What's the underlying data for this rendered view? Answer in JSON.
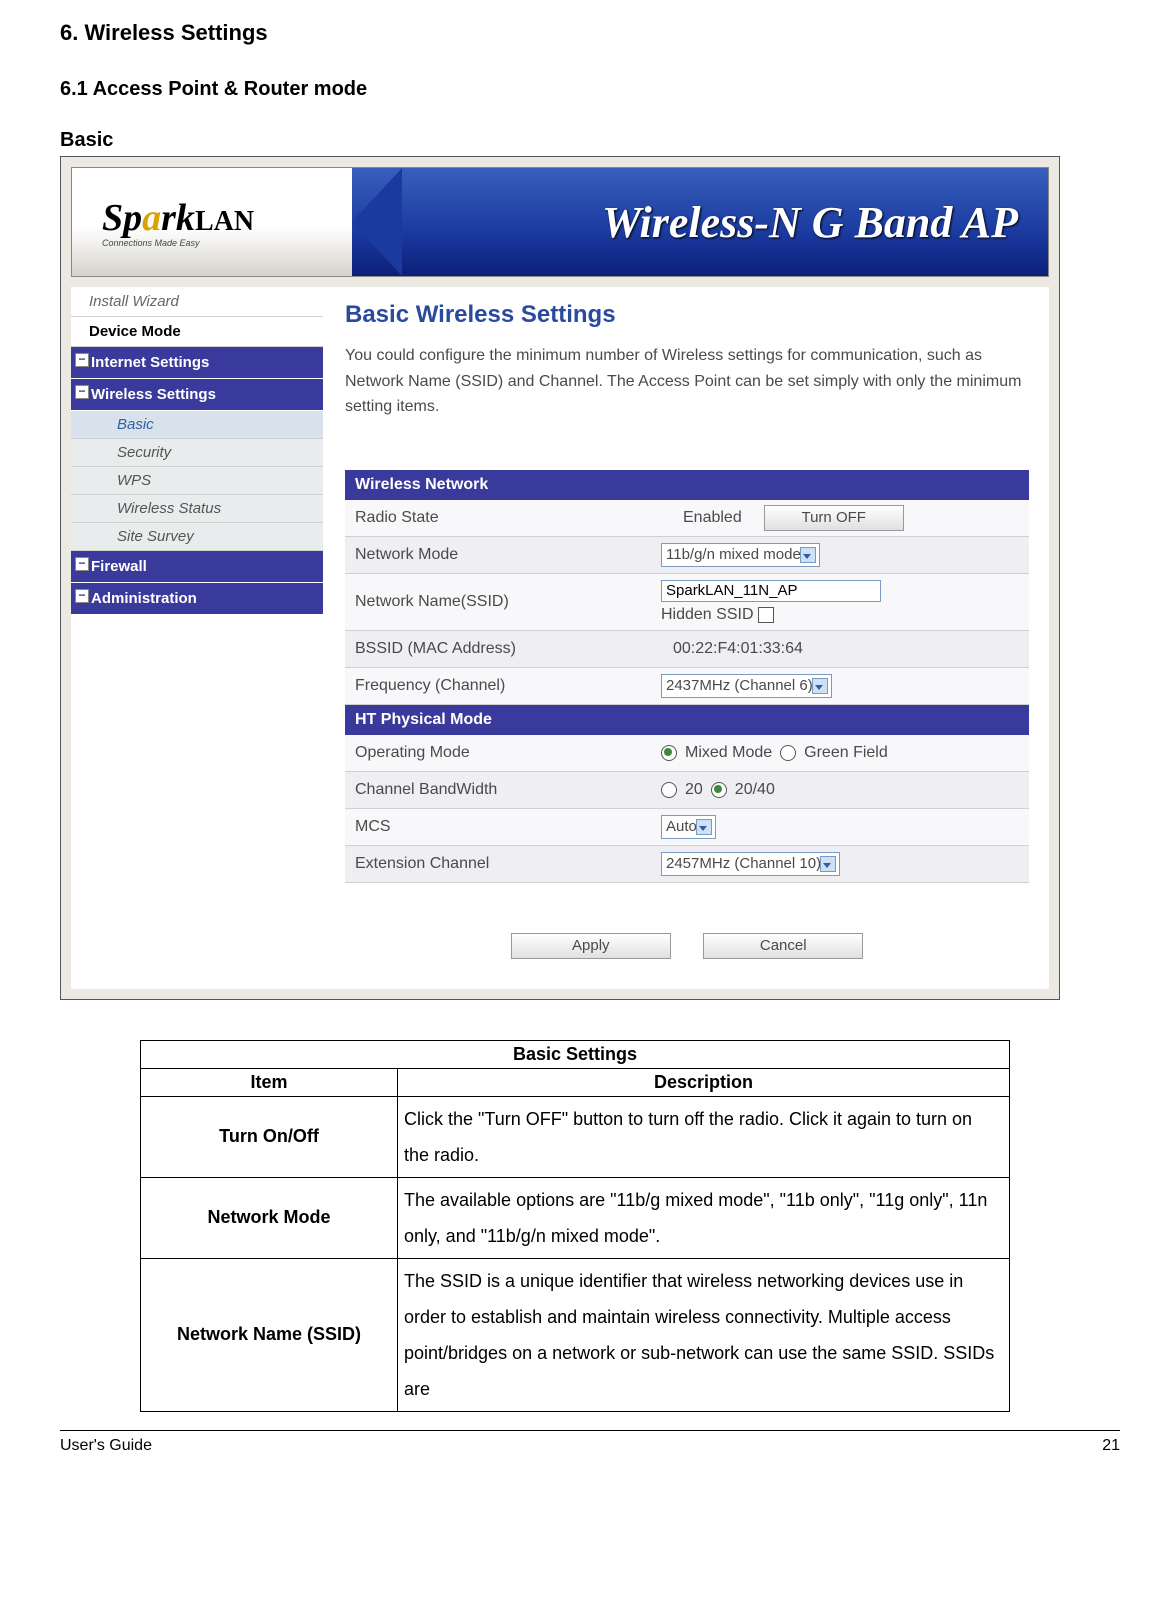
{
  "doc": {
    "h1": "6. Wireless Settings",
    "h2": "6.1 Access Point & Router mode",
    "h3": "Basic"
  },
  "banner": {
    "brand_prefix": "Sp",
    "brand_accent": "a",
    "brand_suffix": "rk",
    "brand_tail": "LAN",
    "brand_tagline": "Connections Made Easy",
    "slogan": "Wireless-N G Band AP"
  },
  "sidebar": {
    "install_wizard": "Install Wizard",
    "device_mode": "Device Mode",
    "internet_settings": "Internet Settings",
    "wireless_settings": "Wireless Settings",
    "sub": {
      "basic": "Basic",
      "security": "Security",
      "wps": "WPS",
      "wireless_status": "Wireless Status",
      "site_survey": "Site Survey"
    },
    "firewall": "Firewall",
    "administration": "Administration"
  },
  "content": {
    "title": "Basic Wireless Settings",
    "desc": "You could configure the minimum number of Wireless settings for communication, such as Network Name (SSID) and Channel. The Access Point can be set simply with only the minimum setting items.",
    "section1": "Wireless Network",
    "radio_state_label": "Radio State",
    "radio_state_value": "Enabled",
    "radio_button": "Turn OFF",
    "network_mode_label": "Network Mode",
    "network_mode_value": "11b/g/n mixed mode",
    "ssid_label": "Network Name(SSID)",
    "ssid_value": "SparkLAN_11N_AP",
    "hidden_ssid": "Hidden SSID",
    "bssid_label": "BSSID (MAC Address)",
    "bssid_value": "00:22:F4:01:33:64",
    "freq_label": "Frequency (Channel)",
    "freq_value": "2437MHz (Channel 6)",
    "section2": "HT Physical Mode",
    "opmode_label": "Operating Mode",
    "opmode_opt1": "Mixed Mode",
    "opmode_opt2": "Green Field",
    "bw_label": "Channel BandWidth",
    "bw_opt1": "20",
    "bw_opt2": "20/40",
    "mcs_label": "MCS",
    "mcs_value": "Auto",
    "ext_label": "Extension Channel",
    "ext_value": "2457MHz (Channel 10)",
    "apply": "Apply",
    "cancel": "Cancel"
  },
  "table": {
    "caption": "Basic Settings",
    "h_item": "Item",
    "h_desc": "Description",
    "rows": [
      {
        "item": "Turn On/Off",
        "desc": "Click the \"Turn OFF\" button to turn off the radio. Click it again to turn on the radio."
      },
      {
        "item": "Network Mode",
        "desc": "The available options are \"11b/g mixed mode\", \"11b only\", \"11g only\", 11n only, and \"11b/g/n mixed mode\"."
      },
      {
        "item": "Network Name (SSID)",
        "desc": "The SSID is a unique identifier that wireless networking devices use in order to establish and maintain wireless connectivity. Multiple access point/bridges on a network or sub-network can use the same SSID. SSIDs are"
      }
    ]
  },
  "footer": {
    "left": "User's Guide",
    "right": "21"
  }
}
